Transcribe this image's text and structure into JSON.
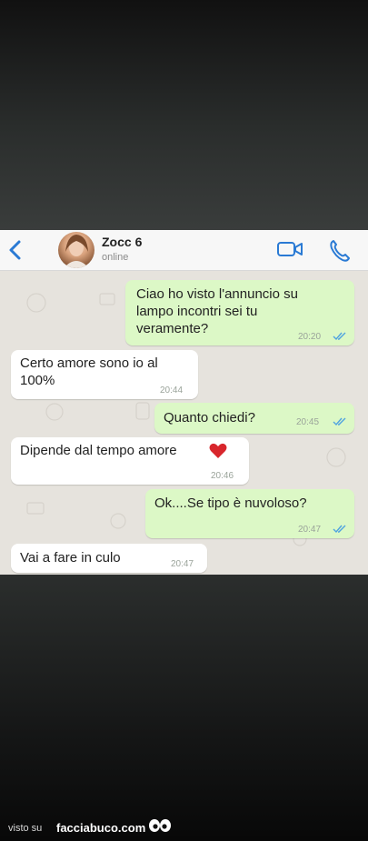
{
  "chat": {
    "contact_name": "Zocc 6",
    "status": "online"
  },
  "messages": [
    {
      "direction": "out",
      "text_lines": [
        "Ciao ho visto l'annuncio su",
        "lampo incontri sei tu",
        "veramente?"
      ],
      "time": "20:20",
      "read": true
    },
    {
      "direction": "in",
      "text_lines": [
        "Certo amore sono io al",
        "100%"
      ],
      "time": "20:44"
    },
    {
      "direction": "out",
      "text_lines": [
        "Quanto chiedi?"
      ],
      "time": "20:45",
      "read": true
    },
    {
      "direction": "in",
      "text_lines": [
        "Dipende dal tempo amore"
      ],
      "emoji": "red-heart",
      "time": "20:46"
    },
    {
      "direction": "out",
      "text_lines": [
        "Ok....Se tipo è nuvoloso?"
      ],
      "time": "20:47",
      "read": true
    },
    {
      "direction": "in",
      "text_lines": [
        "Vai a fare in culo"
      ],
      "time": "20:47"
    }
  ],
  "footer": {
    "prefix": "visto su",
    "brand": "facciabuco.com"
  },
  "colors": {
    "accent": "#2a7ad4",
    "outgoing_bubble": "#dcf8c6",
    "incoming_bubble": "#ffffff",
    "read_ticks": "#4fa3e0"
  }
}
